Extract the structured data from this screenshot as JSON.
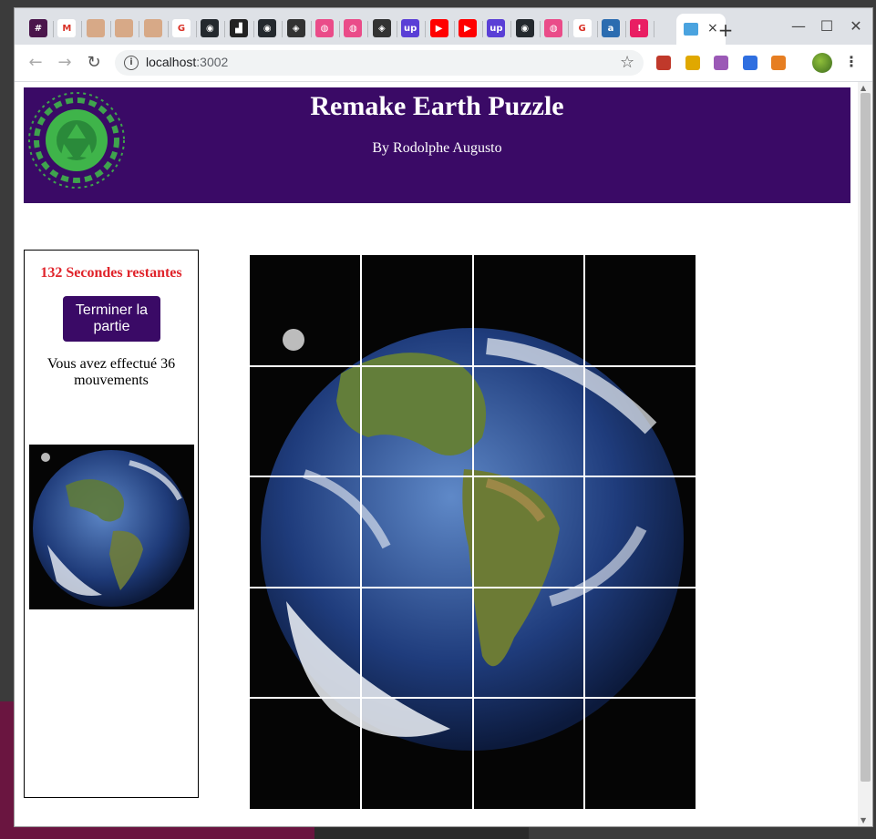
{
  "browser": {
    "url_host": "localhost",
    "url_port": ":3002",
    "tab_close": "×",
    "new_tab": "+",
    "win_min": "—",
    "win_max": "☐",
    "win_close": "✕",
    "back": "←",
    "forward": "→",
    "reload": "↻",
    "star": "☆",
    "menu": "⋮",
    "info": "i",
    "tabs": [
      {
        "icon": "slack-icon",
        "color": "#4a154b",
        "glyph": "#"
      },
      {
        "icon": "gmail-icon",
        "color": "#ffffff",
        "glyph": "M"
      },
      {
        "icon": "avatar-icon",
        "color": "#d7a987",
        "glyph": ""
      },
      {
        "icon": "avatar-icon",
        "color": "#d7a987",
        "glyph": ""
      },
      {
        "icon": "avatar-icon",
        "color": "#d7a987",
        "glyph": ""
      },
      {
        "icon": "google-icon",
        "color": "#ffffff",
        "glyph": "G"
      },
      {
        "icon": "github-icon",
        "color": "#24292e",
        "glyph": "◉"
      },
      {
        "icon": "bitbucket-icon",
        "color": "#222222",
        "glyph": "▟"
      },
      {
        "icon": "github-icon",
        "color": "#24292e",
        "glyph": "◉"
      },
      {
        "icon": "codesandbox-icon",
        "color": "#333333",
        "glyph": "◈"
      },
      {
        "icon": "dribbble-icon",
        "color": "#ea4c89",
        "glyph": "◍"
      },
      {
        "icon": "dribbble-icon",
        "color": "#ea4c89",
        "glyph": "◍"
      },
      {
        "icon": "codesandbox-icon",
        "color": "#333333",
        "glyph": "◈"
      },
      {
        "icon": "upwork-icon",
        "color": "#5a3fd6",
        "glyph": "up"
      },
      {
        "icon": "youtube-icon",
        "color": "#ff0000",
        "glyph": "▶"
      },
      {
        "icon": "youtube-icon",
        "color": "#ff0000",
        "glyph": "▶"
      },
      {
        "icon": "upwork-icon",
        "color": "#5a3fd6",
        "glyph": "up"
      },
      {
        "icon": "github-icon",
        "color": "#24292e",
        "glyph": "◉"
      },
      {
        "icon": "dribbble-icon",
        "color": "#ea4c89",
        "glyph": "◍"
      },
      {
        "icon": "google-icon",
        "color": "#ffffff",
        "glyph": "G"
      },
      {
        "icon": "app-icon",
        "color": "#2b6cb0",
        "glyph": "a"
      },
      {
        "icon": "alert-icon",
        "color": "#e91e63",
        "glyph": "!"
      }
    ],
    "extensions": [
      {
        "icon": "extension-red-icon",
        "color": "#c0392b"
      },
      {
        "icon": "extension-folder-icon",
        "color": "#e0a800"
      },
      {
        "icon": "extension-play-icon",
        "color": "#9b59b6"
      },
      {
        "icon": "extension-check-icon",
        "color": "#2f6fe0"
      },
      {
        "icon": "extension-react-icon",
        "color": "#e67e22"
      }
    ]
  },
  "header": {
    "title": "Remake Earth Puzzle",
    "author": "By Rodolphe Augusto",
    "bg_color": "#3a0a66"
  },
  "sidebar": {
    "timer": "132 Secondes restantes",
    "end_button": "Terminer la partie",
    "moves": "Vous avez effectué 36 mouvements"
  },
  "colors": {
    "accent": "#3a0a66",
    "timer": "#e0242b"
  }
}
